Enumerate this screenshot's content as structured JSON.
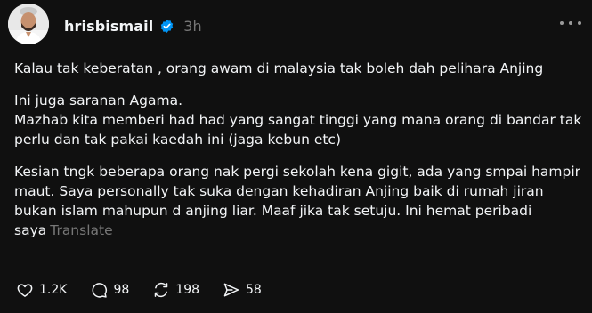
{
  "post": {
    "username": "hrisbismail",
    "time": "3h",
    "paragraphs": [
      "Kalau tak keberatan , orang awam di malaysia tak boleh dah pelihara Anjing",
      "Ini juga saranan Agama.\nMazhab kita memberi had had yang sangat tinggi yang mana orang di bandar tak perlu dan tak pakai kaedah ini (jaga kebun etc)",
      "Kesian tngk beberapa orang nak pergi sekolah kena gigit, ada yang smpai hampir maut. Saya personally tak suka dengan kehadiran Anjing baik di rumah jiran bukan islam mahupun d anjing liar. Maaf jika tak setuju. Ini hemat peribadi saya"
    ],
    "translate_label": "Translate"
  },
  "actions": {
    "likes": "1.2K",
    "replies": "98",
    "reposts": "198",
    "shares": "58"
  },
  "icons": {
    "verified": "verified-badge-icon",
    "more": "more-horizontal-icon",
    "like": "heart-icon",
    "reply": "comment-bubble-icon",
    "repost": "repost-icon",
    "share": "send-icon"
  },
  "colors": {
    "background": "#101010",
    "text": "#f3f5f7",
    "muted": "#777777",
    "verified": "#0095f6"
  }
}
